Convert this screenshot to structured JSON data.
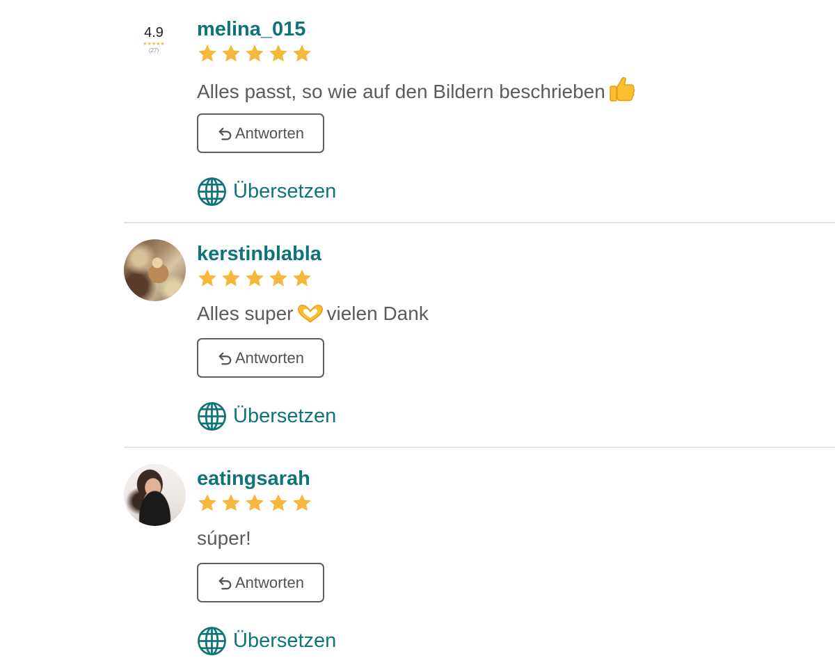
{
  "colors": {
    "accent": "#0f7479",
    "star": "#f6b73c",
    "text": "#5b5b5b",
    "button_border": "#5b5f61",
    "divider": "#e3e3e3"
  },
  "reviews": [
    {
      "avatar": {
        "type": "rating-badge",
        "score": "4.9",
        "stars": "★★★★★",
        "count": "(27)"
      },
      "username": "melina_015",
      "rating": 5,
      "comment": "Alles passt, so wie auf den Bildern beschrieben",
      "comment_emoji": "thumbs-up-icon",
      "reply_label": "Antworten",
      "translate_label": "Übersetzen"
    },
    {
      "avatar": {
        "type": "photo",
        "icon": "user-photo-avatar"
      },
      "username": "kerstinblabla",
      "rating": 5,
      "comment_before": "Alles super",
      "comment_emoji": "heart-hands-icon",
      "comment_after": "vielen Dank",
      "reply_label": "Antworten",
      "translate_label": "Übersetzen"
    },
    {
      "avatar": {
        "type": "photo",
        "icon": "user-photo-avatar"
      },
      "username": "eatingsarah",
      "rating": 5,
      "comment": "súper!",
      "reply_label": "Antworten",
      "translate_label": "Übersetzen"
    }
  ]
}
